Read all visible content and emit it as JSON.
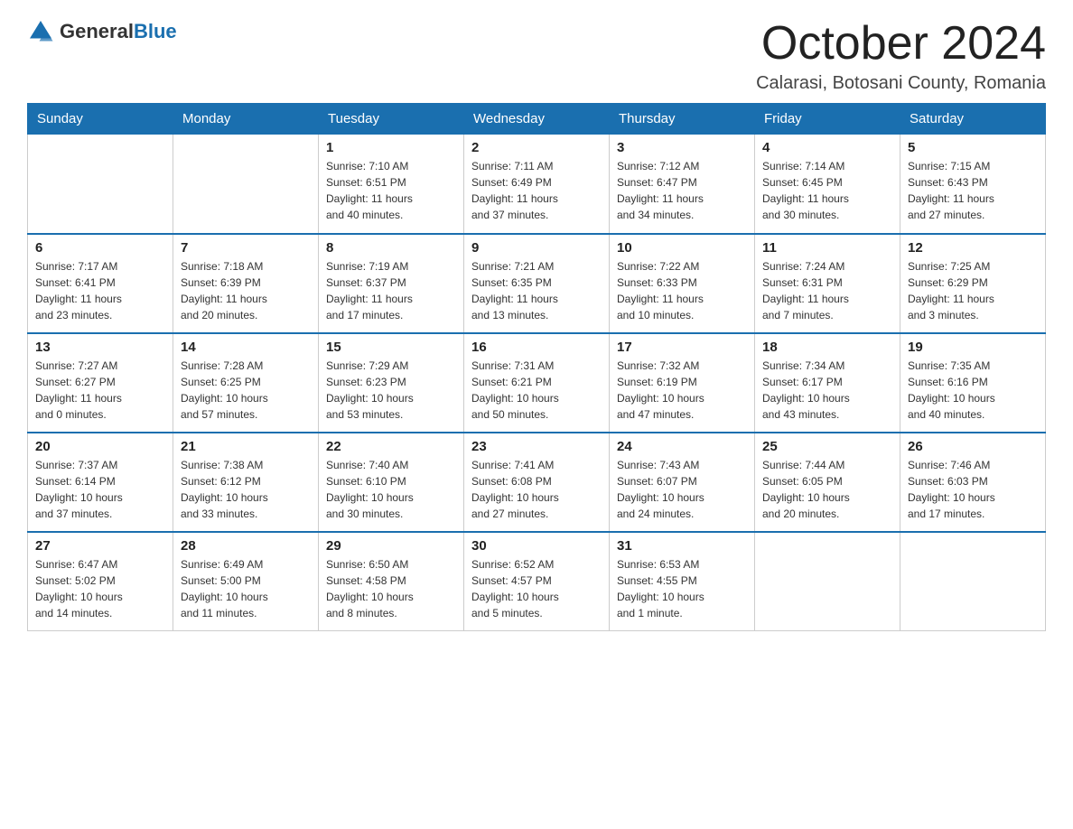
{
  "header": {
    "logo_general": "General",
    "logo_blue": "Blue",
    "month_title": "October 2024",
    "location": "Calarasi, Botosani County, Romania"
  },
  "calendar": {
    "days_of_week": [
      "Sunday",
      "Monday",
      "Tuesday",
      "Wednesday",
      "Thursday",
      "Friday",
      "Saturday"
    ],
    "weeks": [
      [
        {
          "day": "",
          "info": ""
        },
        {
          "day": "",
          "info": ""
        },
        {
          "day": "1",
          "info": "Sunrise: 7:10 AM\nSunset: 6:51 PM\nDaylight: 11 hours\nand 40 minutes."
        },
        {
          "day": "2",
          "info": "Sunrise: 7:11 AM\nSunset: 6:49 PM\nDaylight: 11 hours\nand 37 minutes."
        },
        {
          "day": "3",
          "info": "Sunrise: 7:12 AM\nSunset: 6:47 PM\nDaylight: 11 hours\nand 34 minutes."
        },
        {
          "day": "4",
          "info": "Sunrise: 7:14 AM\nSunset: 6:45 PM\nDaylight: 11 hours\nand 30 minutes."
        },
        {
          "day": "5",
          "info": "Sunrise: 7:15 AM\nSunset: 6:43 PM\nDaylight: 11 hours\nand 27 minutes."
        }
      ],
      [
        {
          "day": "6",
          "info": "Sunrise: 7:17 AM\nSunset: 6:41 PM\nDaylight: 11 hours\nand 23 minutes."
        },
        {
          "day": "7",
          "info": "Sunrise: 7:18 AM\nSunset: 6:39 PM\nDaylight: 11 hours\nand 20 minutes."
        },
        {
          "day": "8",
          "info": "Sunrise: 7:19 AM\nSunset: 6:37 PM\nDaylight: 11 hours\nand 17 minutes."
        },
        {
          "day": "9",
          "info": "Sunrise: 7:21 AM\nSunset: 6:35 PM\nDaylight: 11 hours\nand 13 minutes."
        },
        {
          "day": "10",
          "info": "Sunrise: 7:22 AM\nSunset: 6:33 PM\nDaylight: 11 hours\nand 10 minutes."
        },
        {
          "day": "11",
          "info": "Sunrise: 7:24 AM\nSunset: 6:31 PM\nDaylight: 11 hours\nand 7 minutes."
        },
        {
          "day": "12",
          "info": "Sunrise: 7:25 AM\nSunset: 6:29 PM\nDaylight: 11 hours\nand 3 minutes."
        }
      ],
      [
        {
          "day": "13",
          "info": "Sunrise: 7:27 AM\nSunset: 6:27 PM\nDaylight: 11 hours\nand 0 minutes."
        },
        {
          "day": "14",
          "info": "Sunrise: 7:28 AM\nSunset: 6:25 PM\nDaylight: 10 hours\nand 57 minutes."
        },
        {
          "day": "15",
          "info": "Sunrise: 7:29 AM\nSunset: 6:23 PM\nDaylight: 10 hours\nand 53 minutes."
        },
        {
          "day": "16",
          "info": "Sunrise: 7:31 AM\nSunset: 6:21 PM\nDaylight: 10 hours\nand 50 minutes."
        },
        {
          "day": "17",
          "info": "Sunrise: 7:32 AM\nSunset: 6:19 PM\nDaylight: 10 hours\nand 47 minutes."
        },
        {
          "day": "18",
          "info": "Sunrise: 7:34 AM\nSunset: 6:17 PM\nDaylight: 10 hours\nand 43 minutes."
        },
        {
          "day": "19",
          "info": "Sunrise: 7:35 AM\nSunset: 6:16 PM\nDaylight: 10 hours\nand 40 minutes."
        }
      ],
      [
        {
          "day": "20",
          "info": "Sunrise: 7:37 AM\nSunset: 6:14 PM\nDaylight: 10 hours\nand 37 minutes."
        },
        {
          "day": "21",
          "info": "Sunrise: 7:38 AM\nSunset: 6:12 PM\nDaylight: 10 hours\nand 33 minutes."
        },
        {
          "day": "22",
          "info": "Sunrise: 7:40 AM\nSunset: 6:10 PM\nDaylight: 10 hours\nand 30 minutes."
        },
        {
          "day": "23",
          "info": "Sunrise: 7:41 AM\nSunset: 6:08 PM\nDaylight: 10 hours\nand 27 minutes."
        },
        {
          "day": "24",
          "info": "Sunrise: 7:43 AM\nSunset: 6:07 PM\nDaylight: 10 hours\nand 24 minutes."
        },
        {
          "day": "25",
          "info": "Sunrise: 7:44 AM\nSunset: 6:05 PM\nDaylight: 10 hours\nand 20 minutes."
        },
        {
          "day": "26",
          "info": "Sunrise: 7:46 AM\nSunset: 6:03 PM\nDaylight: 10 hours\nand 17 minutes."
        }
      ],
      [
        {
          "day": "27",
          "info": "Sunrise: 6:47 AM\nSunset: 5:02 PM\nDaylight: 10 hours\nand 14 minutes."
        },
        {
          "day": "28",
          "info": "Sunrise: 6:49 AM\nSunset: 5:00 PM\nDaylight: 10 hours\nand 11 minutes."
        },
        {
          "day": "29",
          "info": "Sunrise: 6:50 AM\nSunset: 4:58 PM\nDaylight: 10 hours\nand 8 minutes."
        },
        {
          "day": "30",
          "info": "Sunrise: 6:52 AM\nSunset: 4:57 PM\nDaylight: 10 hours\nand 5 minutes."
        },
        {
          "day": "31",
          "info": "Sunrise: 6:53 AM\nSunset: 4:55 PM\nDaylight: 10 hours\nand 1 minute."
        },
        {
          "day": "",
          "info": ""
        },
        {
          "day": "",
          "info": ""
        }
      ]
    ]
  }
}
